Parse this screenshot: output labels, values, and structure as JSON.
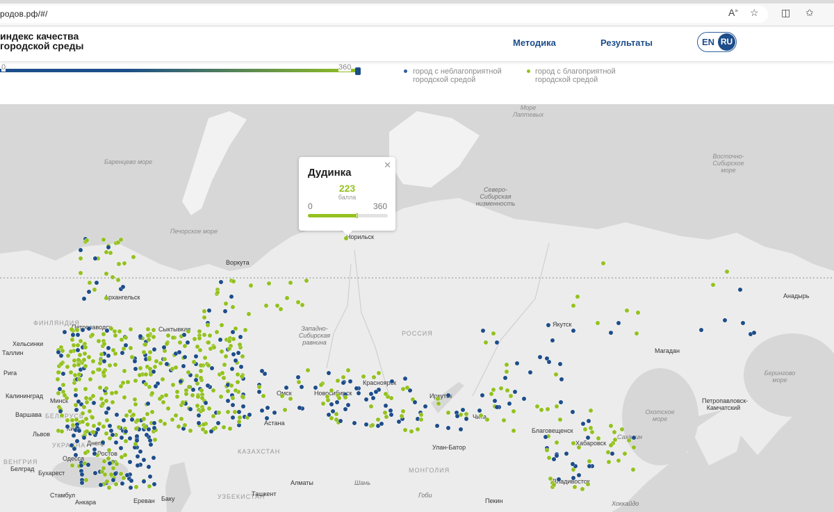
{
  "browser": {
    "address": "родов.рф/#/",
    "icons": [
      "read-aloud-icon",
      "favorite-star-icon",
      "split-screen-icon",
      "favorites-icon"
    ]
  },
  "header": {
    "title_line1": "индекс качества",
    "title_line2": "городской среды",
    "nav": [
      "Методика",
      "Результаты"
    ],
    "lang_en": "EN",
    "lang_ru": "RU",
    "active_lang": "RU"
  },
  "filter": {
    "range_min": "0",
    "range_max": "360",
    "legend": [
      {
        "label_line1": "город с неблагоприятной",
        "label_line2": "городской средой",
        "color": "#2e5f9e"
      },
      {
        "label_line1": "город с благоприятной",
        "label_line2": "городской средой",
        "color": "#94c11f"
      }
    ]
  },
  "popup": {
    "city": "Дудинка",
    "score": "223",
    "score_label": "балла",
    "min": "0",
    "max": "360",
    "score_value": 223,
    "max_value": 360
  },
  "map": {
    "colors": {
      "unfavorable": "#1d4d8a",
      "favorable": "#94c11f"
    },
    "labels": {
      "seas": [
        "Баренцево море",
        "Печорское море",
        "Море Лаптевых",
        "Восточно-Сибирское море",
        "Берингово море",
        "Охотское море"
      ],
      "regions": [
        "Северо-Сибирская низменность",
        "Западно-Сибирская равнина"
      ],
      "cities": [
        "Норильск",
        "Воркута",
        "Архангельск",
        "Петрозаводск",
        "Сыктывкар",
        "Хельсинки",
        "Таллин",
        "Рига",
        "Калининград",
        "Минск",
        "Варшава",
        "Киев",
        "Львов",
        "Днепр",
        "Ростов",
        "Одесса",
        "Белград",
        "Бухарест",
        "Стамбул",
        "Анкара",
        "Ереван",
        "Баку",
        "Омск",
        "Новосибирск",
        "Красноярск",
        "Астана",
        "Алматы",
        "Ташкент",
        "Иркутск",
        "Чита",
        "Улан-Батор",
        "Благовещенск",
        "Хабаровск",
        "Якутск",
        "Магадан",
        "Анадырь",
        "Петропавловск-Камчатский",
        "Владивосток",
        "Пекин",
        "Шань",
        "Гоби"
      ],
      "countries": [
        "ФИНЛЯНДИЯ",
        "РОССИЯ",
        "КАЗАХСТАН",
        "УЗБЕКИСТАН",
        "МОНГОЛИЯ",
        "БЕЛАРУСЬ",
        "УКРАИНА",
        "ВЕНГРИЯ",
        "Сахалин",
        "Хоккайдо"
      ]
    }
  }
}
